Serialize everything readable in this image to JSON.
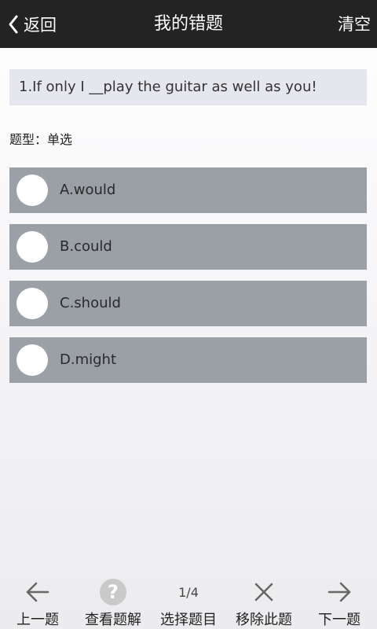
{
  "header": {
    "back_label": "返回",
    "title": "我的错题",
    "clear_label": "清空"
  },
  "question": {
    "text": "1.If only I __play the guitar as well as you!",
    "type_label": "题型：单选",
    "options": [
      {
        "label": "A.would"
      },
      {
        "label": "B.could"
      },
      {
        "label": "C.should"
      },
      {
        "label": "D.might"
      }
    ]
  },
  "bottom": {
    "prev_label": "上一题",
    "explain_label": "查看题解",
    "counter": "1/4",
    "select_label": "选择题目",
    "remove_label": "移除此题",
    "next_label": "下一题"
  },
  "icons": {
    "back": "chevron-left-icon",
    "prev": "arrow-left-icon",
    "explain": "question-circle-icon",
    "remove": "close-icon",
    "next": "arrow-right-icon"
  }
}
